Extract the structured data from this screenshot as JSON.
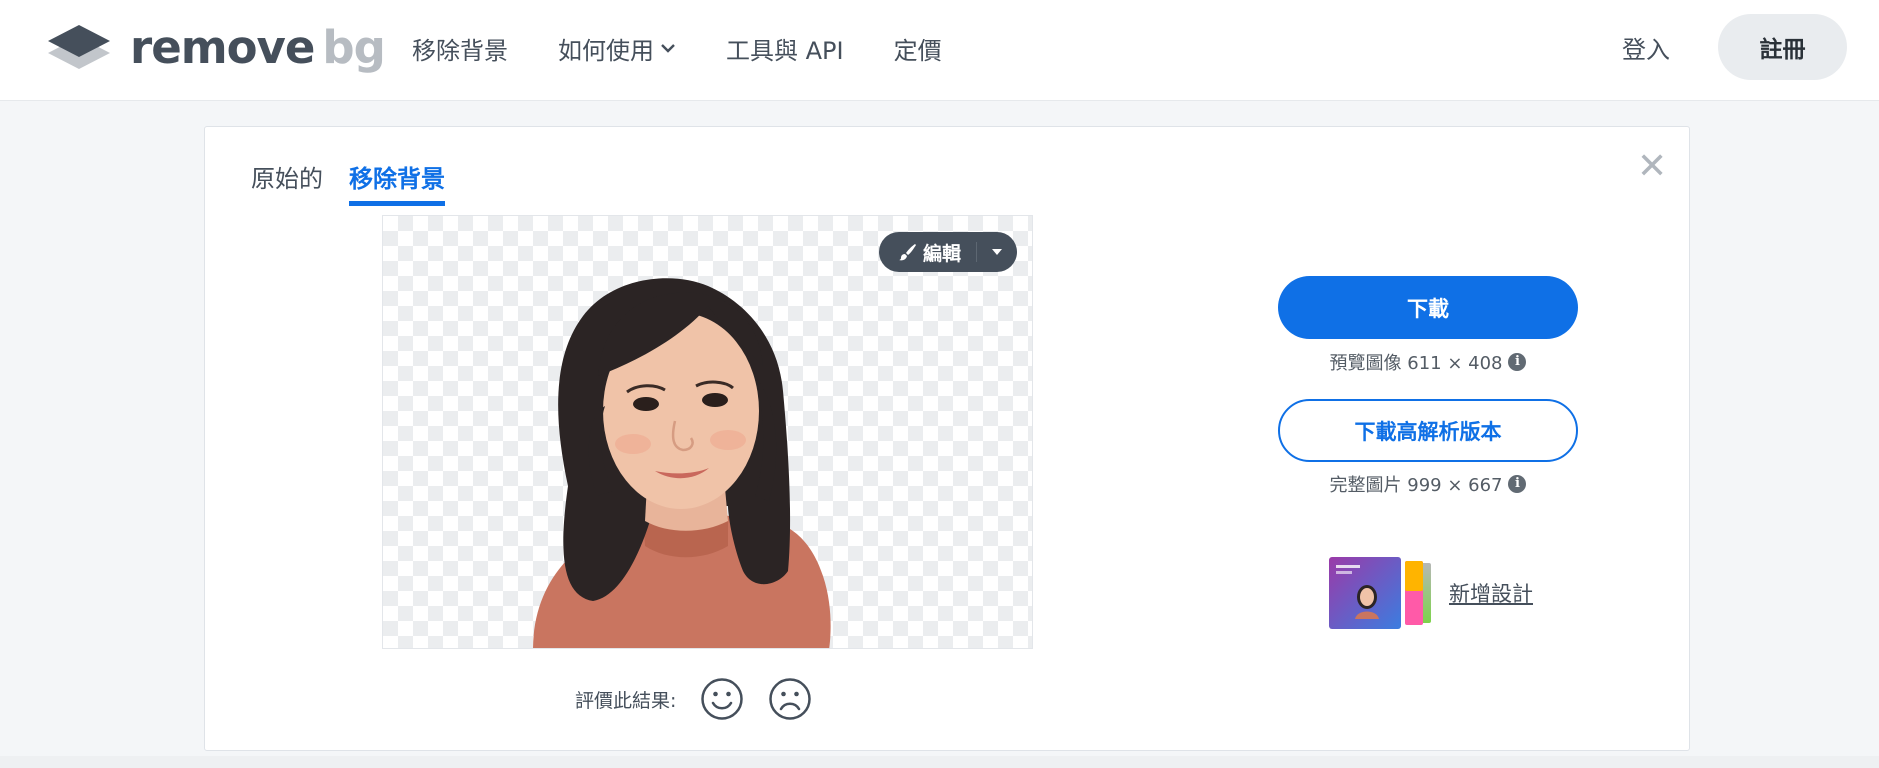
{
  "header": {
    "logo": {
      "word1": "remove",
      "word2": "bg"
    },
    "nav": [
      {
        "label": "移除背景"
      },
      {
        "label": "如何使用",
        "has_dropdown": true
      },
      {
        "label": "工具與 API"
      },
      {
        "label": "定價"
      }
    ],
    "login_label": "登入",
    "signup_label": "註冊"
  },
  "editor": {
    "tabs": [
      {
        "label": "原始的",
        "active": false
      },
      {
        "label": "移除背景",
        "active": true
      }
    ],
    "close_icon": "close-icon",
    "edit_button_label": "編輯",
    "rating_label": "評價此結果:"
  },
  "sidebar": {
    "download_label": "下載",
    "preview_info": "預覽圖像 611 × 408",
    "download_hd_label": "下載高解析版本",
    "full_info": "完整圖片 999 × 667",
    "add_design_label": "新增設計"
  },
  "colors": {
    "accent": "#0f70e6",
    "text": "#454f5b",
    "logo_gray": "#b7bcc2",
    "background": "#f4f6f8"
  }
}
